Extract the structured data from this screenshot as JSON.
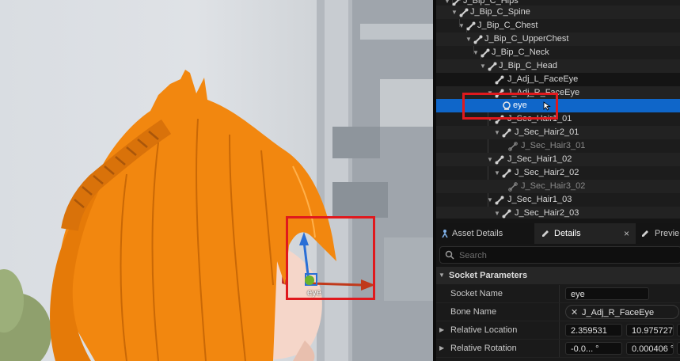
{
  "viewport": {
    "socket_label": "eye"
  },
  "skeleton_tree": {
    "rows": [
      {
        "label": "J_Bip_C_Hips",
        "icon": "bone-icon"
      },
      {
        "label": "J_Bip_C_Spine",
        "icon": "bone-icon"
      },
      {
        "label": "J_Bip_C_Chest",
        "icon": "bone-icon"
      },
      {
        "label": "J_Bip_C_UpperChest",
        "icon": "bone-icon"
      },
      {
        "label": "J_Bip_C_Neck",
        "icon": "bone-icon"
      },
      {
        "label": "J_Bip_C_Head",
        "icon": "bone-icon"
      },
      {
        "label": "J_Adj_L_FaceEye",
        "icon": "bone-icon"
      },
      {
        "label": "J_Adj_R_FaceEye",
        "icon": "bone-icon"
      },
      {
        "label": "eye",
        "icon": "socket-icon",
        "selected": true
      },
      {
        "label": "J_Sec_Hair1_01",
        "icon": "bone-icon"
      },
      {
        "label": "J_Sec_Hair2_01",
        "icon": "bone-icon"
      },
      {
        "label": "J_Sec_Hair3_01",
        "icon": "bone-icon",
        "dim": true
      },
      {
        "label": "J_Sec_Hair1_02",
        "icon": "bone-icon"
      },
      {
        "label": "J_Sec_Hair2_02",
        "icon": "bone-icon"
      },
      {
        "label": "J_Sec_Hair3_02",
        "icon": "bone-icon",
        "dim": true
      },
      {
        "label": "J_Sec_Hair1_03",
        "icon": "bone-icon"
      },
      {
        "label": "J_Sec_Hair2_03",
        "icon": "bone-icon"
      }
    ]
  },
  "tabs": [
    {
      "label": "Asset Details",
      "icon": "asset-details-icon"
    },
    {
      "label": "Details",
      "icon": "pencil-icon",
      "active": true,
      "close": "×"
    },
    {
      "label": "Previe",
      "icon": "pencil-icon"
    }
  ],
  "search": {
    "placeholder": "Search",
    "value": ""
  },
  "details": {
    "section_title": "Socket Parameters",
    "socket_name_label": "Socket Name",
    "socket_name_value": "eye",
    "bone_name_label": "Bone Name",
    "bone_name_value": "J_Adj_R_FaceEye",
    "bone_name_clear": "✕",
    "relative_location_label": "Relative Location",
    "relative_location": [
      "2.359531",
      "10.975727"
    ],
    "relative_rotation_label": "Relative Rotation",
    "relative_rotation": [
      "-0.0... °",
      "0.000406 °"
    ]
  },
  "colors": {
    "selection": "#0f66c9",
    "highlight_box": "#e0191d",
    "hair": "#f28a12"
  }
}
